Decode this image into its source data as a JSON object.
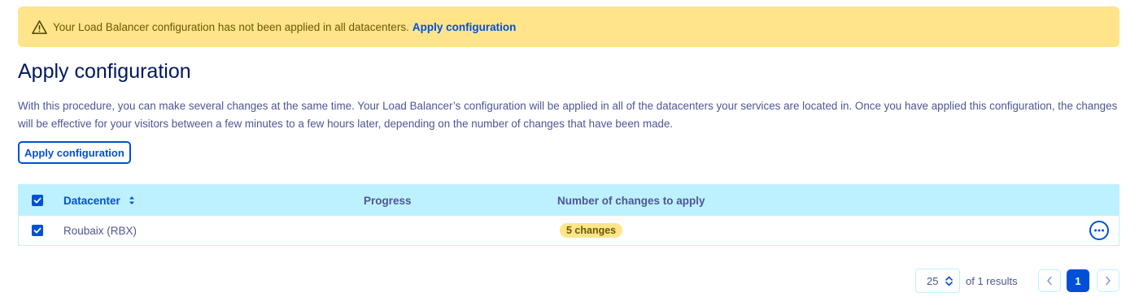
{
  "banner": {
    "icon": "warning-triangle-icon",
    "message": "Your Load Balancer configuration has not been applied in all datacenters.",
    "link_label": "Apply configuration"
  },
  "page": {
    "title": "Apply configuration",
    "description": "With this procedure, you can make several changes at the same time. Your Load Balancer’s configuration will be applied in all of the datacenters your services are located in. Once you have applied this configuration, the changes will be effective for your visitors between a few minutes to a few hours later, depending on the number of changes that have been made.",
    "apply_button_label": "Apply configuration"
  },
  "table": {
    "columns": {
      "datacenter": "Datacenter",
      "progress": "Progress",
      "changes": "Number of changes to apply"
    },
    "rows": [
      {
        "checked": true,
        "datacenter": "Roubaix (RBX)",
        "progress": "",
        "changes": "5 changes"
      }
    ],
    "header_checked": true
  },
  "pagination": {
    "page_size": "25",
    "results_text": "of 1 results",
    "current_page": "1"
  },
  "colors": {
    "accent": "#0050d7",
    "banner_bg": "#ffe48a",
    "header_bg": "#bef1ff",
    "title": "#00185e",
    "text": "#4d5693"
  }
}
